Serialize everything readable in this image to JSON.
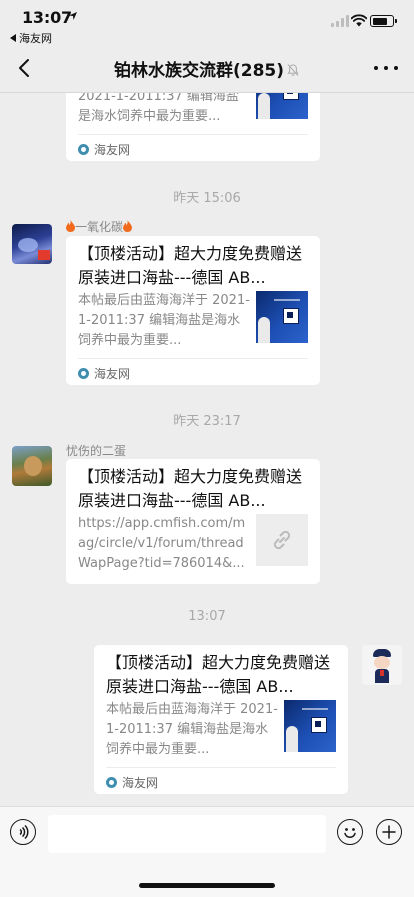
{
  "status_bar": {
    "time": "13:07",
    "back_app": "海友网"
  },
  "header": {
    "title": "铂林水族交流群(285)"
  },
  "messages": [
    {
      "type": "link_card",
      "side": "left",
      "partially_visible": true,
      "desc_lines": [
        "2021-1-2011:37 编辑海盐",
        "是海水饲养中最为重要..."
      ],
      "source": "海友网"
    },
    {
      "type": "timestamp",
      "text": "昨天 15:06"
    },
    {
      "type": "link_card",
      "side": "left",
      "sender": "一氧化碳",
      "title": "【顶楼活动】超大力度免费赠送原装进口海盐---德国 AB...",
      "desc": "本帖最后由蓝海海洋于 2021-1-2011:37 编辑海盐是海水饲养中最为重要...",
      "source": "海友网"
    },
    {
      "type": "timestamp",
      "text": "昨天 23:17"
    },
    {
      "type": "link_card",
      "side": "left",
      "sender": "忧伤的二蛋",
      "title": "【顶楼活动】超大力度免费赠送原装进口海盐---德国 AB...",
      "desc": "https://app.cmfish.com/mag/circle/v1/forum/threadWapPage?tid=786014&..."
    },
    {
      "type": "timestamp",
      "text": "13:07"
    },
    {
      "type": "link_card",
      "side": "right",
      "title": "【顶楼活动】超大力度免费赠送原装进口海盐---德国 AB...",
      "desc": "本帖最后由蓝海海洋于 2021-1-2011:37 编辑海盐是海水饲养中最为重要...",
      "source": "海友网"
    }
  ],
  "input_bar": {
    "voice_icon": "voice-icon",
    "emoji_icon": "emoji-icon",
    "plus_icon": "plus-icon"
  },
  "colors": {
    "background": "#ededed",
    "bubble": "#ffffff",
    "muted_text": "#888888"
  }
}
